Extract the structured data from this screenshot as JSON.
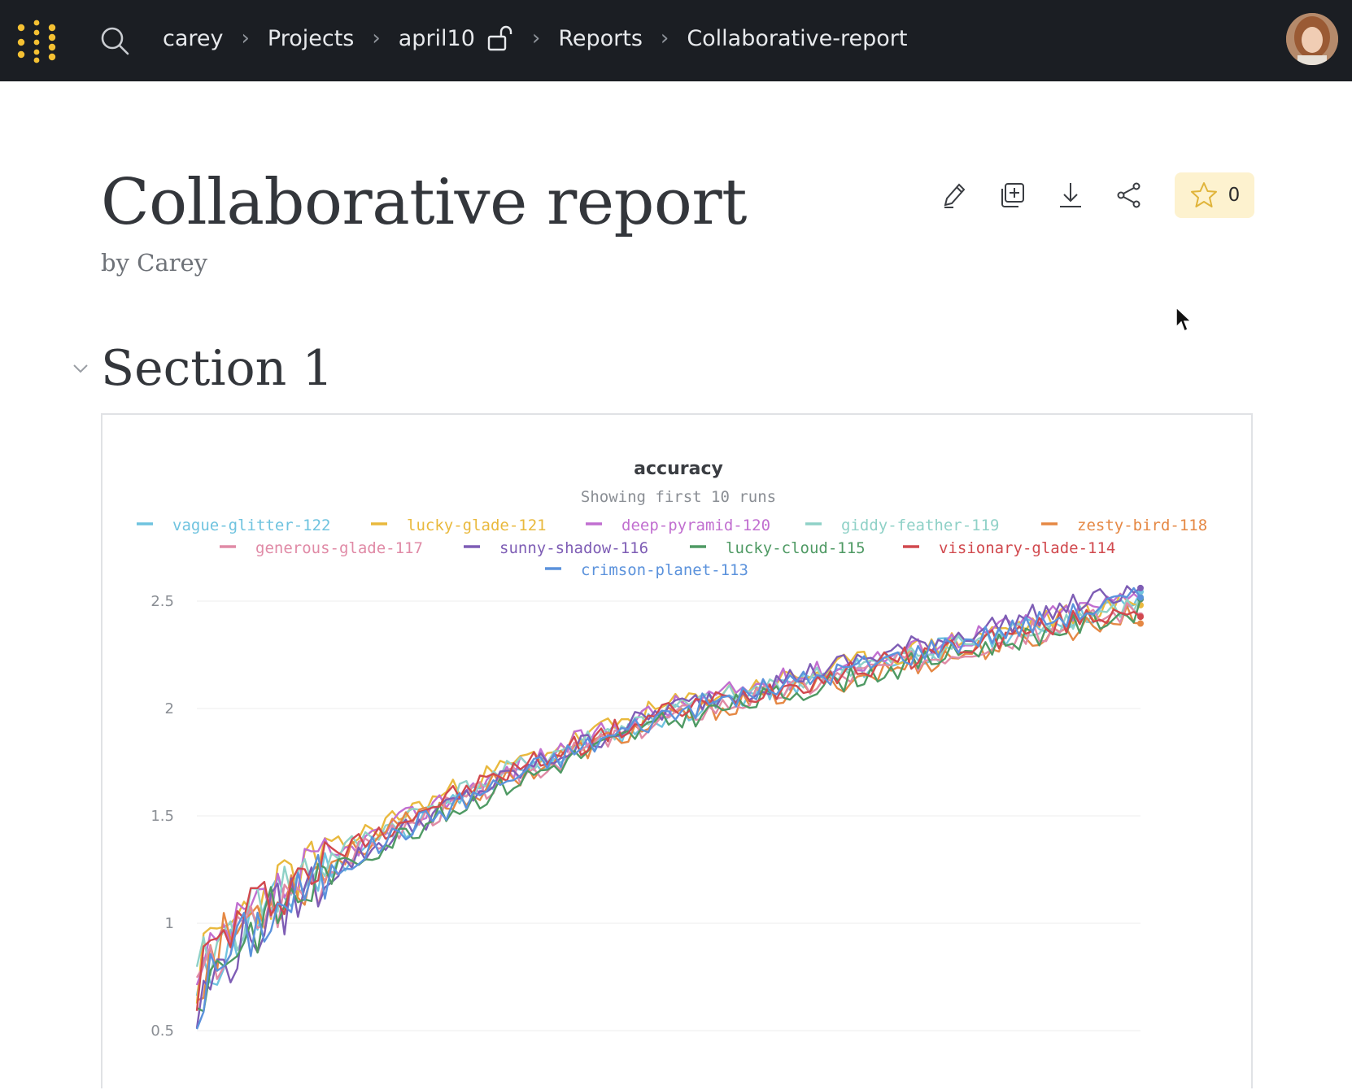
{
  "breadcrumb": [
    "carey",
    "Projects",
    "april10",
    "Reports",
    "Collaborative-report"
  ],
  "colors": {
    "topbar": "#1b1e23",
    "logo": "#f5c133",
    "star_bg": "#fdf2cf",
    "accent_star": "#e0b43a"
  },
  "icons": {
    "logo": "dots-logo-icon",
    "search": "search-icon",
    "lock": "unlock-icon",
    "actions": [
      "pencil-icon",
      "copy-add-icon",
      "download-icon",
      "share-icon"
    ],
    "star": "star-icon",
    "collapse": "chevron-down-icon"
  },
  "report": {
    "title": "Collaborative report",
    "byline": "by Carey",
    "star_count": "0"
  },
  "section": {
    "title": "Section 1"
  },
  "chart_data": {
    "type": "line",
    "title": "accuracy",
    "subtitle": "Showing first 10 runs",
    "xlabel": "",
    "ylabel": "",
    "grid": true,
    "legend_placement": "top",
    "ylim": [
      0.5,
      2.5
    ],
    "yticks": [
      2.5,
      2,
      1.5,
      1,
      0.5
    ],
    "xlim": [
      0,
      140
    ],
    "series": [
      {
        "name": "vague-glitter-122",
        "color": "#6fc3df",
        "start": 0.62,
        "end": 2.5,
        "seed": 11
      },
      {
        "name": "lucky-glade-121",
        "color": "#e9b93d",
        "start": 0.73,
        "end": 2.51,
        "seed": 23
      },
      {
        "name": "deep-pyramid-120",
        "color": "#c16fd0",
        "start": 0.66,
        "end": 2.53,
        "seed": 37
      },
      {
        "name": "giddy-feather-119",
        "color": "#8fd1c7",
        "start": 0.7,
        "end": 2.49,
        "seed": 41
      },
      {
        "name": "zesty-bird-118",
        "color": "#e58844",
        "start": 0.69,
        "end": 2.44,
        "seed": 53
      },
      {
        "name": "generous-glade-117",
        "color": "#e08aa6",
        "start": 0.64,
        "end": 2.47,
        "seed": 67
      },
      {
        "name": "sunny-shadow-116",
        "color": "#7e5db5",
        "start": 0.55,
        "end": 2.56,
        "seed": 79
      },
      {
        "name": "lucky-cloud-115",
        "color": "#4f9a64",
        "start": 0.6,
        "end": 2.46,
        "seed": 83
      },
      {
        "name": "visionary-glade-114",
        "color": "#d1494e",
        "start": 0.71,
        "end": 2.48,
        "seed": 97
      },
      {
        "name": "crimson-planet-113",
        "color": "#5b92dc",
        "start": 0.58,
        "end": 2.52,
        "seed": 101
      }
    ]
  }
}
